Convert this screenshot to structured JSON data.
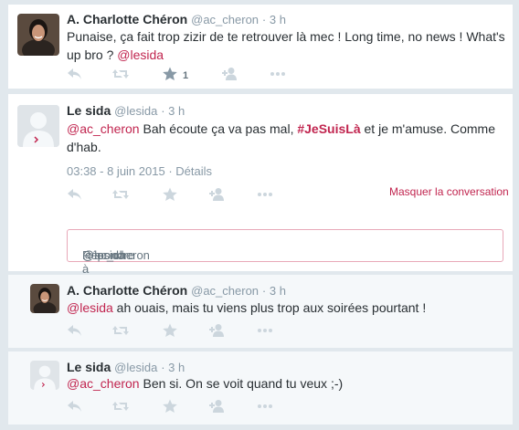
{
  "tweets": [
    {
      "name": "A. Charlotte Chéron",
      "handle": "@ac_cheron",
      "time": "· 3 h",
      "text_a": "Punaise, ça fait trop zizir de te retrouver là mec ! Long time, no news ! What's",
      "text_b": "up bro ? ",
      "mention": "@lesida",
      "fav_count": "1"
    },
    {
      "name": "Le sida",
      "handle": "@lesida",
      "time": "· 3 h",
      "mention": "@ac_cheron",
      "text_a": " Bah écoute ça va pas mal, ",
      "hashtag": "#JeSuisLà",
      "text_b": " et je m'amuse. Comme",
      "text_c": "d'hab.",
      "timestamp": "03:38 - 8 juin 2015",
      "details": "· Détails",
      "hide_label": "Masquer la conversation"
    },
    {
      "name": "A. Charlotte Chéron",
      "handle": "@ac_cheron",
      "time": "· 3 h",
      "mention": "@lesida",
      "text": " ah ouais, mais tu viens plus trop aux soirées pourtant !"
    },
    {
      "name": "Le sida",
      "handle": "@lesida",
      "time": "· 3 h",
      "mention": "@ac_cheron",
      "text": " Ben si. On se voit quand tu veux ;-)"
    }
  ],
  "reply_box": {
    "prefix": "Répondre à ",
    "mention_1": "@lesida",
    "mention_2": " @ac_cheron"
  },
  "colors": {
    "accent": "#c1254f",
    "muted": "#8899a6",
    "icon": "#ccd6dd",
    "background": "#e1e8ed"
  },
  "icons": [
    "reply-icon",
    "retweet-icon",
    "favorite-icon",
    "follow-icon",
    "more-icon"
  ]
}
